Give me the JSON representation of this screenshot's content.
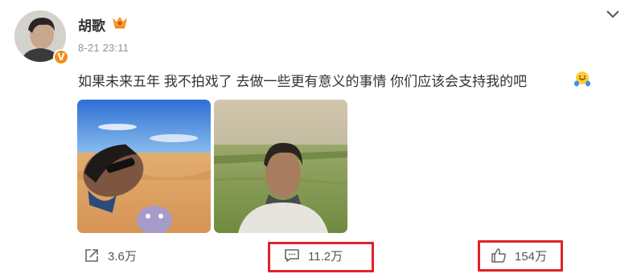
{
  "post": {
    "username": "胡歌",
    "timestamp": "8-21 23:11",
    "text": "如果未来五年 我不拍戏了 去做一些更有意义的事情 你们应该会支持我的吧",
    "verified_badge": "V"
  },
  "actions": {
    "repost_count": "3.6万",
    "comment_count": "11.2万",
    "like_count": "154万"
  },
  "colors": {
    "highlight": "#e0212a",
    "verified": "#f58b15",
    "text": "#333333",
    "meta": "#939393"
  },
  "icons": [
    "crown-icon",
    "chevron-down-icon",
    "smile-emoji-icon",
    "share-icon",
    "comment-icon",
    "thumbs-up-icon",
    "verified-icon"
  ]
}
